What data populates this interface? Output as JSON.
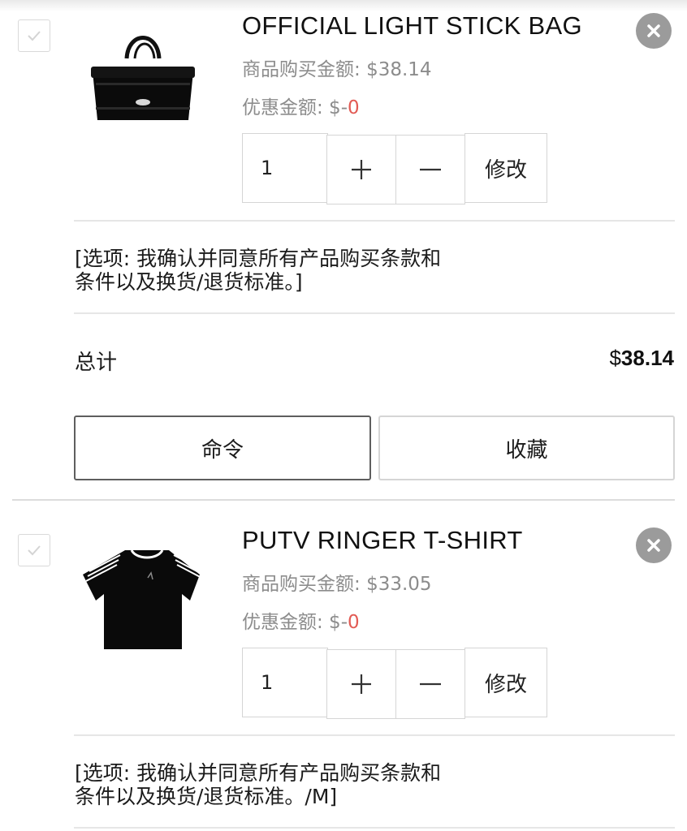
{
  "items": [
    {
      "title": "OFFICIAL LIGHT STICK BAG",
      "purchase_label": "商品购买金额: ",
      "purchase_amount": "$38.14",
      "discount_label": "优惠金额: $-",
      "discount_amount": "0",
      "quantity": "1",
      "plus_label": "+",
      "minus_label": "—",
      "edit_label": "修改",
      "option_line1": "[选项: 我确认并同意所有产品购买条款和",
      "option_line2": "条件以及换货/退货标准。]",
      "image_icon": "tote-bag-icon"
    },
    {
      "title": "PUTV RINGER T-SHIRT",
      "purchase_label": "商品购买金额: ",
      "purchase_amount": "$33.05",
      "discount_label": "优惠金额: $-",
      "discount_amount": "0",
      "quantity": "1",
      "plus_label": "+",
      "minus_label": "—",
      "edit_label": "修改",
      "option_line1": "[选项: 我确认并同意所有产品购买条款和",
      "option_line2": "条件以及换货/退货标准。/M]",
      "image_icon": "tshirt-icon"
    }
  ],
  "summary": {
    "total_label": "总计",
    "total_currency": "$",
    "total_value": "38.14",
    "order_button": "命令",
    "wishlist_button": "收藏"
  },
  "colors": {
    "discount_red": "#e25b54",
    "remove_button_gray": "#9b9b9b",
    "muted_text": "#8c8c8c"
  }
}
